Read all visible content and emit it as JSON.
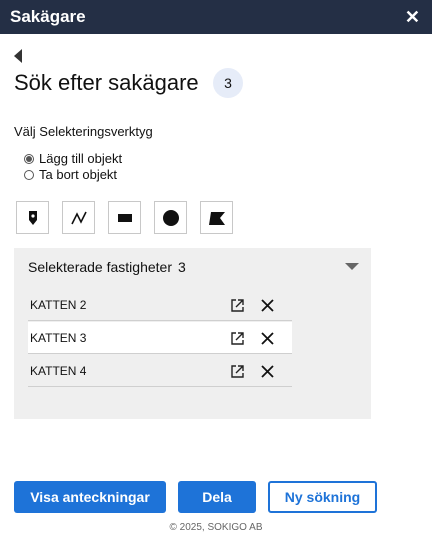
{
  "window": {
    "title": "Sakägare",
    "close_symbol": "✕"
  },
  "page": {
    "heading": "Sök efter sakägare",
    "count_badge": "3"
  },
  "selection_tool": {
    "label": "Välj Selekteringsverktyg",
    "options": [
      {
        "label": "Lägg till objekt",
        "checked": true
      },
      {
        "label": "Ta bort objekt",
        "checked": false
      }
    ],
    "tools": [
      "point-tool-icon",
      "line-tool-icon",
      "rectangle-tool-icon",
      "circle-tool-icon",
      "polygon-tool-icon"
    ]
  },
  "selected_properties": {
    "title": "Selekterade fastigheter",
    "count": "3",
    "items": [
      {
        "name": "KATTEN 2"
      },
      {
        "name": "KATTEN 3",
        "selected": true
      },
      {
        "name": "KATTEN 4"
      }
    ]
  },
  "actions": {
    "notes_label": "Visa anteckningar",
    "share_label": "Dela",
    "new_search_label": "Ny sökning"
  },
  "footer": {
    "copyright": "© 2025, SOKIGO AB"
  },
  "colors": {
    "titlebar": "#242f45",
    "primary": "#1e73d8",
    "panel": "#efefef",
    "badge": "#e6ecf8"
  }
}
